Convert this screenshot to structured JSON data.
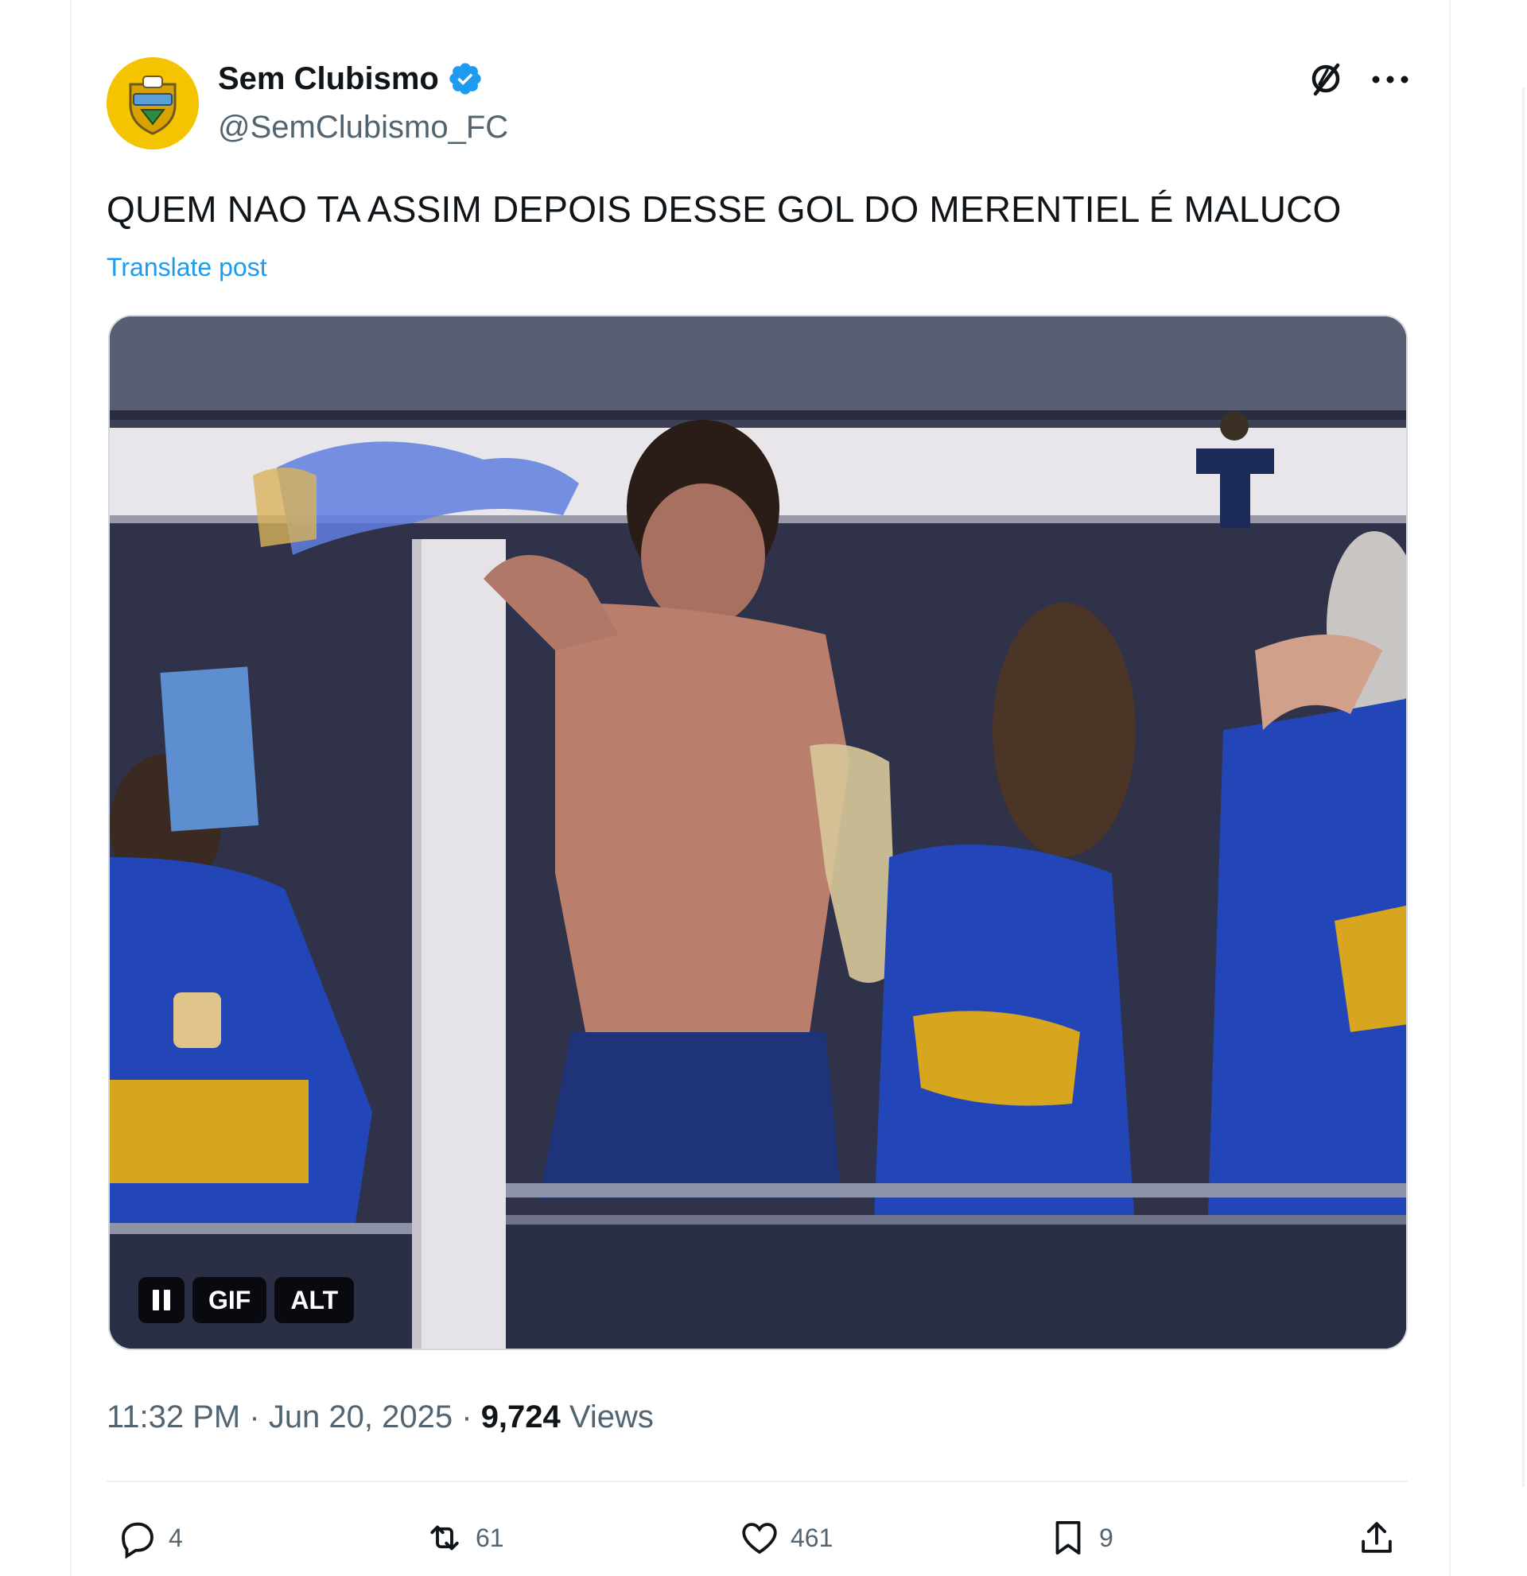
{
  "account": {
    "display_name": "Sem Clubismo",
    "handle": "@SemClubismo_FC",
    "verified": true,
    "avatar_icon": "shield-logo-icon"
  },
  "post": {
    "text": "QUEM NAO TA ASSIM DEPOIS DESSE GOL DO MERENTIEL É MALUCO",
    "translate_label": "Translate post",
    "time": "11:32 PM",
    "date": "Jun 20, 2025",
    "views_count": "9,724",
    "views_label": "Views"
  },
  "media": {
    "type": "gif",
    "pause_icon": "pause-icon",
    "gif_label": "GIF",
    "alt_label": "ALT"
  },
  "actions": {
    "replies": "4",
    "reposts": "61",
    "likes": "461",
    "bookmarks": "9"
  },
  "colors": {
    "accent": "#1d9bf0",
    "text_primary": "#0f1419",
    "text_secondary": "#536471",
    "avatar_bg": "#f5c400"
  }
}
